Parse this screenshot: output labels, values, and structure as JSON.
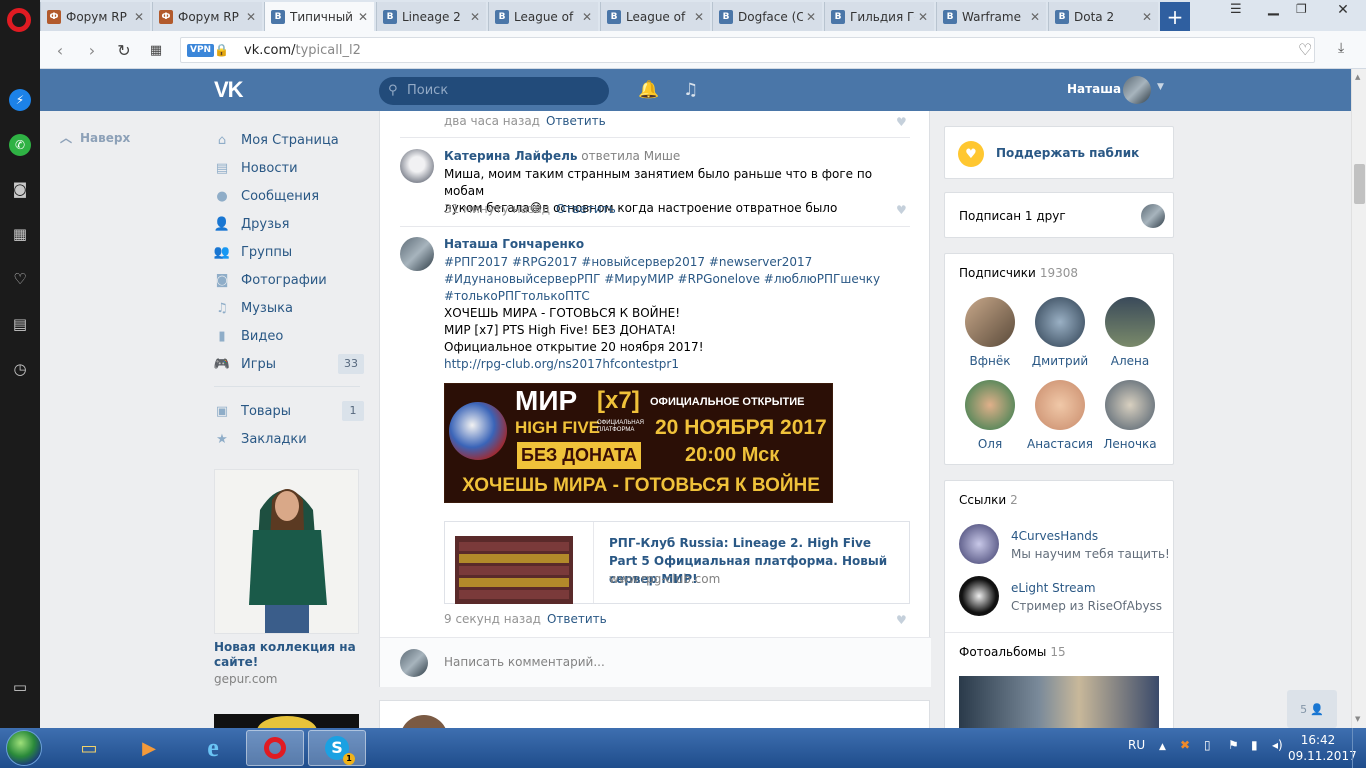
{
  "browser": {
    "tabs": [
      {
        "label": "Форум RP",
        "icon": "forum-favicon-icon"
      },
      {
        "label": "Форум RP",
        "icon": "forum-favicon-icon"
      },
      {
        "label": "Типичный",
        "icon": "vk-favicon-icon",
        "active": true
      },
      {
        "label": "Lineage 2",
        "icon": "vk-favicon-icon"
      },
      {
        "label": "League of",
        "icon": "vk-favicon-icon"
      },
      {
        "label": "League of",
        "icon": "vk-favicon-icon"
      },
      {
        "label": "Dogface (C",
        "icon": "vk-favicon-icon"
      },
      {
        "label": "Гильдия Ге",
        "icon": "vk-favicon-icon"
      },
      {
        "label": "Warframe",
        "icon": "vk-favicon-icon"
      },
      {
        "label": "Dota 2",
        "icon": "vk-favicon-icon"
      }
    ],
    "url_host": "vk.com/",
    "url_path": "typicall_l2",
    "vpn_badge": "VPN"
  },
  "vk_header": {
    "logo": "VK",
    "search_placeholder": "Поиск",
    "user_name": "Наташа"
  },
  "left_nav": {
    "back_to_top": "Наверх",
    "items": [
      {
        "label": "Моя Страница",
        "icon": "home-icon"
      },
      {
        "label": "Новости",
        "icon": "news-icon"
      },
      {
        "label": "Сообщения",
        "icon": "messages-icon"
      },
      {
        "label": "Друзья",
        "icon": "friends-icon"
      },
      {
        "label": "Группы",
        "icon": "groups-icon"
      },
      {
        "label": "Фотографии",
        "icon": "camera-icon"
      },
      {
        "label": "Музыка",
        "icon": "music-icon"
      },
      {
        "label": "Видео",
        "icon": "video-icon"
      },
      {
        "label": "Игры",
        "icon": "gamepad-icon",
        "count": "33"
      },
      {
        "label": "Товары",
        "icon": "bag-icon",
        "count": "1"
      },
      {
        "label": "Закладки",
        "icon": "star-icon"
      }
    ],
    "ad": {
      "title": "Новая коллекция на сайте!",
      "domain": "gepur.com"
    }
  },
  "feed": {
    "top_time": "два часа назад",
    "reply_label": "Ответить",
    "comment1": {
      "author": "Катерина Лайфель",
      "replied": "ответила Мише",
      "text_line1": "Миша, моим таким странным занятием было раньше что в фоге по мобам",
      "text_line2": "луком бегала😅в основном когда настроение отвратное было",
      "time": "31 минуту назад"
    },
    "comment2": {
      "author": "Наташа Гончаренко",
      "tags_line1": "#РПГ2017 #RPG2017 #новыйсервер2017 #newserver2017",
      "tags_line2": "#ИдунановыйсерверРПГ #МируМИР #RPGonelove #люблюРПГшечку",
      "tags_line3": "#толькоРПГтолькоПТС",
      "line1": "ХОЧЕШЬ МИРА - ГОТОВЬСЯ К ВОЙНЕ!",
      "line2": "МИР [x7] PTS High Five! БЕЗ ДОНАТА!",
      "line3": "Официальное открытие 20 ноября 2017!",
      "link": "http://rpg-club.org/ns2017hfcontestpr1",
      "banner": {
        "mir": "МИР",
        "x7": "[x7]",
        "official_open": "ОФИЦИАЛЬНОЕ ОТКРЫТИЕ",
        "high_five": "HIGH FIVE",
        "platform": "ОФИЦИАЛЬНАЯ ПЛАТФОРМА",
        "date": "20 НОЯБРЯ 2017",
        "no_donate": "БЕЗ ДОНАТА",
        "time": "20:00 Мск",
        "slogan": "ХОЧЕШЬ МИРА - ГОТОВЬСЯ К ВОЙНЕ"
      },
      "snippet": {
        "title": "РПГ-Клуб Russia: Lineage 2. High Five Part 5 Официальная платформа. Новый сервер МИР!",
        "domain": "www.rpg-club.com"
      },
      "time": "9 секунд назад"
    },
    "write_placeholder": "Написать комментарий..."
  },
  "right": {
    "support": "Поддержать паблик",
    "subscribed": "Подписан 1 друг",
    "subscribers_label": "Подписчики",
    "subscribers_count": "19308",
    "subscribers": [
      "Вфнёк",
      "Дмитрий",
      "Алена",
      "Оля",
      "Анастасия",
      "Леночка"
    ],
    "links_label": "Ссылки",
    "links_count": "2",
    "links": [
      {
        "title": "4CurvesHands",
        "sub": "Мы научим тебя тащить!"
      },
      {
        "title": "eLight Stream",
        "sub": "Стример из RiseOfAbyss"
      }
    ],
    "albums_label": "Фотоальбомы",
    "albums_count": "15",
    "chat_count": "5"
  },
  "taskbar": {
    "lang": "RU",
    "time": "16:42",
    "date": "09.11.2017",
    "skype_badge": "1"
  },
  "colors": {
    "vk_blue": "#4a76a8",
    "link": "#2a5885",
    "opera_red": "#e01b22"
  }
}
